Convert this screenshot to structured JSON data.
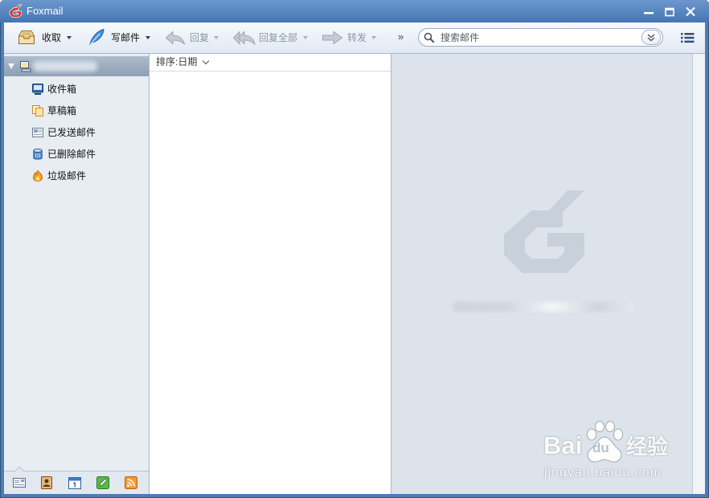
{
  "window": {
    "title": "Foxmail",
    "controls": [
      "minimize-icon",
      "maximize-icon",
      "close-icon"
    ]
  },
  "toolbar": {
    "receive": {
      "label": "收取",
      "icon": "inbox-tray-icon",
      "enabled": true
    },
    "compose": {
      "label": "写邮件",
      "icon": "feather-pen-icon",
      "enabled": true
    },
    "reply": {
      "label": "回复",
      "icon": "reply-arrow-icon",
      "enabled": false
    },
    "reply_all": {
      "label": "回复全部",
      "icon": "reply-all-arrow-icon",
      "enabled": false
    },
    "forward": {
      "label": "转发",
      "icon": "forward-arrow-icon",
      "enabled": false
    },
    "more_label": "»",
    "search": {
      "placeholder": "搜索邮件",
      "value": "",
      "icon": "search-icon"
    },
    "menu_icon": "list-menu-icon"
  },
  "sidebar": {
    "account": {
      "expanded": true,
      "icon": "computer-icon"
    },
    "folders": [
      {
        "label": "收件箱",
        "icon": "inbox-icon"
      },
      {
        "label": "草稿箱",
        "icon": "drafts-icon"
      },
      {
        "label": "已发送邮件",
        "icon": "sent-mail-icon"
      },
      {
        "label": "已删除邮件",
        "icon": "trash-icon"
      },
      {
        "label": "垃圾邮件",
        "icon": "spam-flame-icon"
      }
    ],
    "bottom_tabs": [
      {
        "icon": "mail-icon",
        "selected": true
      },
      {
        "icon": "contacts-icon",
        "selected": false
      },
      {
        "icon": "calendar-icon",
        "selected": false
      },
      {
        "icon": "notes-icon",
        "selected": false
      },
      {
        "icon": "rss-icon",
        "selected": false
      }
    ]
  },
  "message_list": {
    "sort_label": "排序:日期"
  },
  "preview": {
    "logo_icon": "foxmail-g-logo-icon"
  },
  "watermark": {
    "brand": "Bai",
    "paw_text": "du",
    "suffix": "经验",
    "url": "jingyan.baidu.com"
  },
  "colors": {
    "frame": "#4e7cb5",
    "title_bar": "#4676b3",
    "toolbar_bg": "#e1e9f3",
    "sidebar_bg": "#e8edf3",
    "account_row": "#8d9fb4",
    "preview_bg": "#dde3ea",
    "logo_watermark": "#c8d0d9",
    "disabled_text": "#8a96a5",
    "brand_red": "#d8261e"
  }
}
